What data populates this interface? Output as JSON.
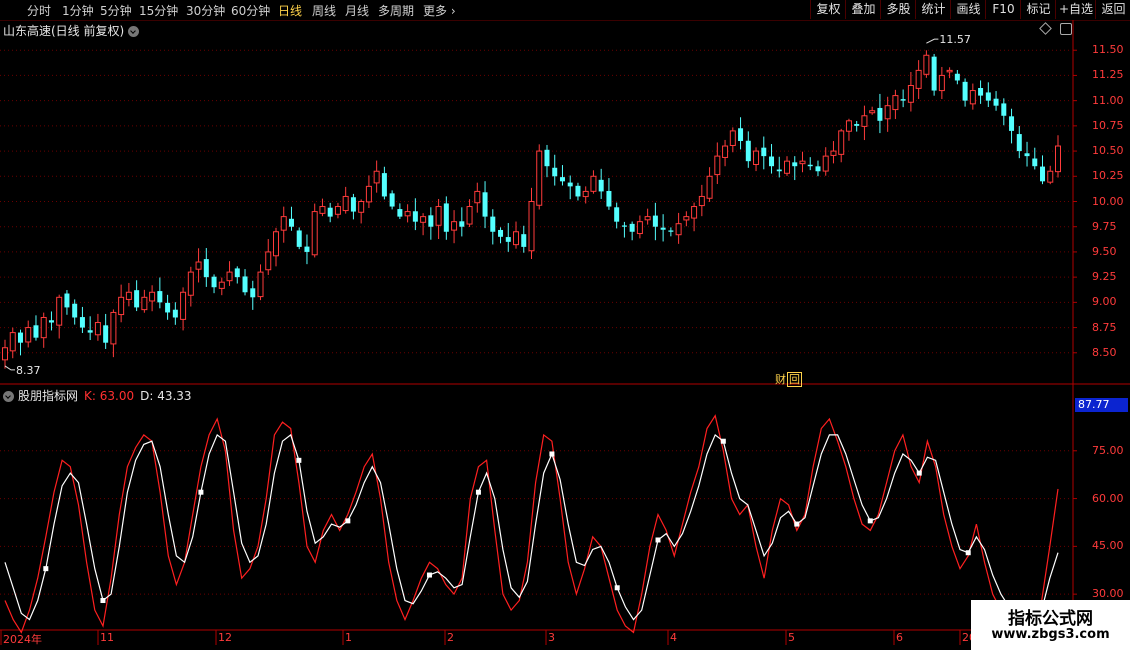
{
  "toolbar": {
    "periods": [
      "分时",
      "1分钟",
      "5分钟",
      "15分钟",
      "30分钟",
      "60分钟",
      "日线",
      "周线",
      "月线",
      "多周期",
      "更多"
    ],
    "active_period": "日线",
    "right_buttons": [
      "复权",
      "叠加",
      "多股",
      "统计",
      "画线",
      "F10",
      "标记",
      "+自选",
      "返回"
    ]
  },
  "main_chart": {
    "title": "山东高速(日线 前复权)",
    "price_ticks": [
      "11.50",
      "11.25",
      "11.00",
      "10.75",
      "10.50",
      "10.25",
      "10.00",
      "9.75",
      "9.50",
      "9.25",
      "9.00",
      "8.75",
      "8.50"
    ],
    "high_label": "11.57",
    "low_label": "8.37",
    "finance_tag": "财",
    "finance_tag_box": "回"
  },
  "indicator": {
    "name": "股朋指标网",
    "k_label": "K: 63.00",
    "d_label": "D: 43.33",
    "current_value": "87.77",
    "ticks": [
      "75.00",
      "60.00",
      "45.00",
      "30.00"
    ]
  },
  "dates": [
    "2024年",
    "11",
    "12",
    "1",
    "2",
    "3",
    "4",
    "5",
    "6",
    "20"
  ],
  "watermark": {
    "title": "指标公式网",
    "url": "www.zbgs3.com"
  },
  "colors": {
    "up": "#ff3b3b",
    "down": "#54ffff",
    "grid": "#6a0000",
    "k_line": "#ff2020",
    "d_line": "#ffffff"
  },
  "chart_data": [
    {
      "type": "candlestick",
      "title": "山东高速(日线 前复权)",
      "ylim": [
        8.25,
        11.75
      ],
      "close": [
        8.55,
        8.7,
        8.6,
        8.75,
        8.65,
        8.85,
        8.8,
        9.05,
        8.95,
        8.85,
        8.75,
        8.7,
        8.8,
        8.6,
        8.9,
        9.05,
        9.1,
        8.95,
        9.05,
        9.1,
        9.0,
        8.9,
        8.85,
        9.1,
        9.3,
        9.4,
        9.25,
        9.15,
        9.2,
        9.3,
        9.25,
        9.1,
        9.05,
        9.3,
        9.5,
        9.7,
        9.85,
        9.75,
        9.55,
        9.5,
        9.9,
        9.95,
        9.85,
        9.95,
        10.05,
        9.9,
        10.0,
        10.15,
        10.3,
        10.05,
        9.95,
        9.85,
        9.9,
        9.8,
        9.85,
        9.75,
        9.95,
        9.7,
        9.8,
        9.75,
        9.95,
        10.1,
        9.85,
        9.7,
        9.65,
        9.6,
        9.7,
        9.55,
        10.0,
        10.5,
        10.35,
        10.25,
        10.2,
        10.15,
        10.05,
        10.1,
        10.25,
        10.1,
        9.95,
        9.8,
        9.75,
        9.7,
        9.8,
        9.85,
        9.75,
        9.72,
        9.7,
        9.78,
        9.85,
        9.95,
        10.05,
        10.25,
        10.45,
        10.55,
        10.7,
        10.6,
        10.4,
        10.5,
        10.45,
        10.35,
        10.3,
        10.4,
        10.35,
        10.4,
        10.35,
        10.3,
        10.45,
        10.5,
        10.7,
        10.8,
        10.75,
        10.85,
        10.9,
        10.8,
        10.95,
        11.05,
        11.0,
        11.15,
        11.3,
        11.45,
        11.1,
        11.25,
        11.3,
        11.2,
        11.0,
        11.1,
        11.05,
        11.0,
        10.95,
        10.85,
        10.7,
        10.5,
        10.45,
        10.35,
        10.2,
        10.3,
        10.55
      ]
    },
    {
      "type": "line",
      "ylim": [
        20,
        90
      ],
      "series": [
        {
          "name": "K",
          "values": [
            28,
            22,
            18,
            25,
            35,
            48,
            62,
            72,
            70,
            58,
            40,
            25,
            20,
            35,
            55,
            70,
            76,
            80,
            78,
            62,
            42,
            33,
            40,
            55,
            70,
            80,
            85,
            75,
            50,
            35,
            38,
            45,
            60,
            80,
            84,
            82,
            65,
            45,
            40,
            50,
            55,
            50,
            55,
            62,
            70,
            74,
            60,
            40,
            28,
            22,
            28,
            35,
            40,
            38,
            33,
            30,
            35,
            60,
            70,
            72,
            50,
            30,
            25,
            28,
            40,
            65,
            80,
            78,
            60,
            40,
            30,
            38,
            48,
            45,
            35,
            25,
            20,
            18,
            30,
            45,
            55,
            50,
            42,
            52,
            62,
            70,
            82,
            86,
            75,
            60,
            55,
            58,
            45,
            35,
            50,
            60,
            58,
            50,
            55,
            70,
            82,
            85,
            78,
            70,
            60,
            52,
            50,
            55,
            65,
            75,
            80,
            70,
            65,
            78,
            70,
            55,
            45,
            38,
            42,
            52,
            40,
            30,
            25,
            22,
            20,
            18,
            22,
            28,
            45,
            63
          ]
        },
        {
          "name": "D",
          "values": [
            40,
            32,
            24,
            22,
            28,
            38,
            52,
            64,
            68,
            65,
            52,
            38,
            28,
            30,
            45,
            62,
            72,
            77,
            78,
            70,
            55,
            42,
            40,
            48,
            62,
            74,
            80,
            78,
            62,
            46,
            40,
            42,
            52,
            68,
            78,
            80,
            72,
            56,
            46,
            48,
            52,
            51,
            53,
            58,
            65,
            70,
            65,
            52,
            38,
            28,
            27,
            31,
            36,
            37,
            35,
            32,
            33,
            48,
            62,
            68,
            60,
            44,
            32,
            29,
            34,
            52,
            68,
            74,
            66,
            52,
            40,
            39,
            44,
            45,
            40,
            32,
            26,
            22,
            25,
            36,
            47,
            49,
            45,
            49,
            56,
            64,
            74,
            80,
            78,
            68,
            60,
            58,
            50,
            42,
            46,
            54,
            56,
            52,
            54,
            64,
            74,
            80,
            80,
            74,
            66,
            58,
            53,
            54,
            60,
            68,
            74,
            72,
            68,
            73,
            72,
            62,
            52,
            44,
            43,
            48,
            44,
            36,
            30,
            26,
            23,
            20,
            21,
            25,
            35,
            43
          ]
        }
      ]
    }
  ]
}
